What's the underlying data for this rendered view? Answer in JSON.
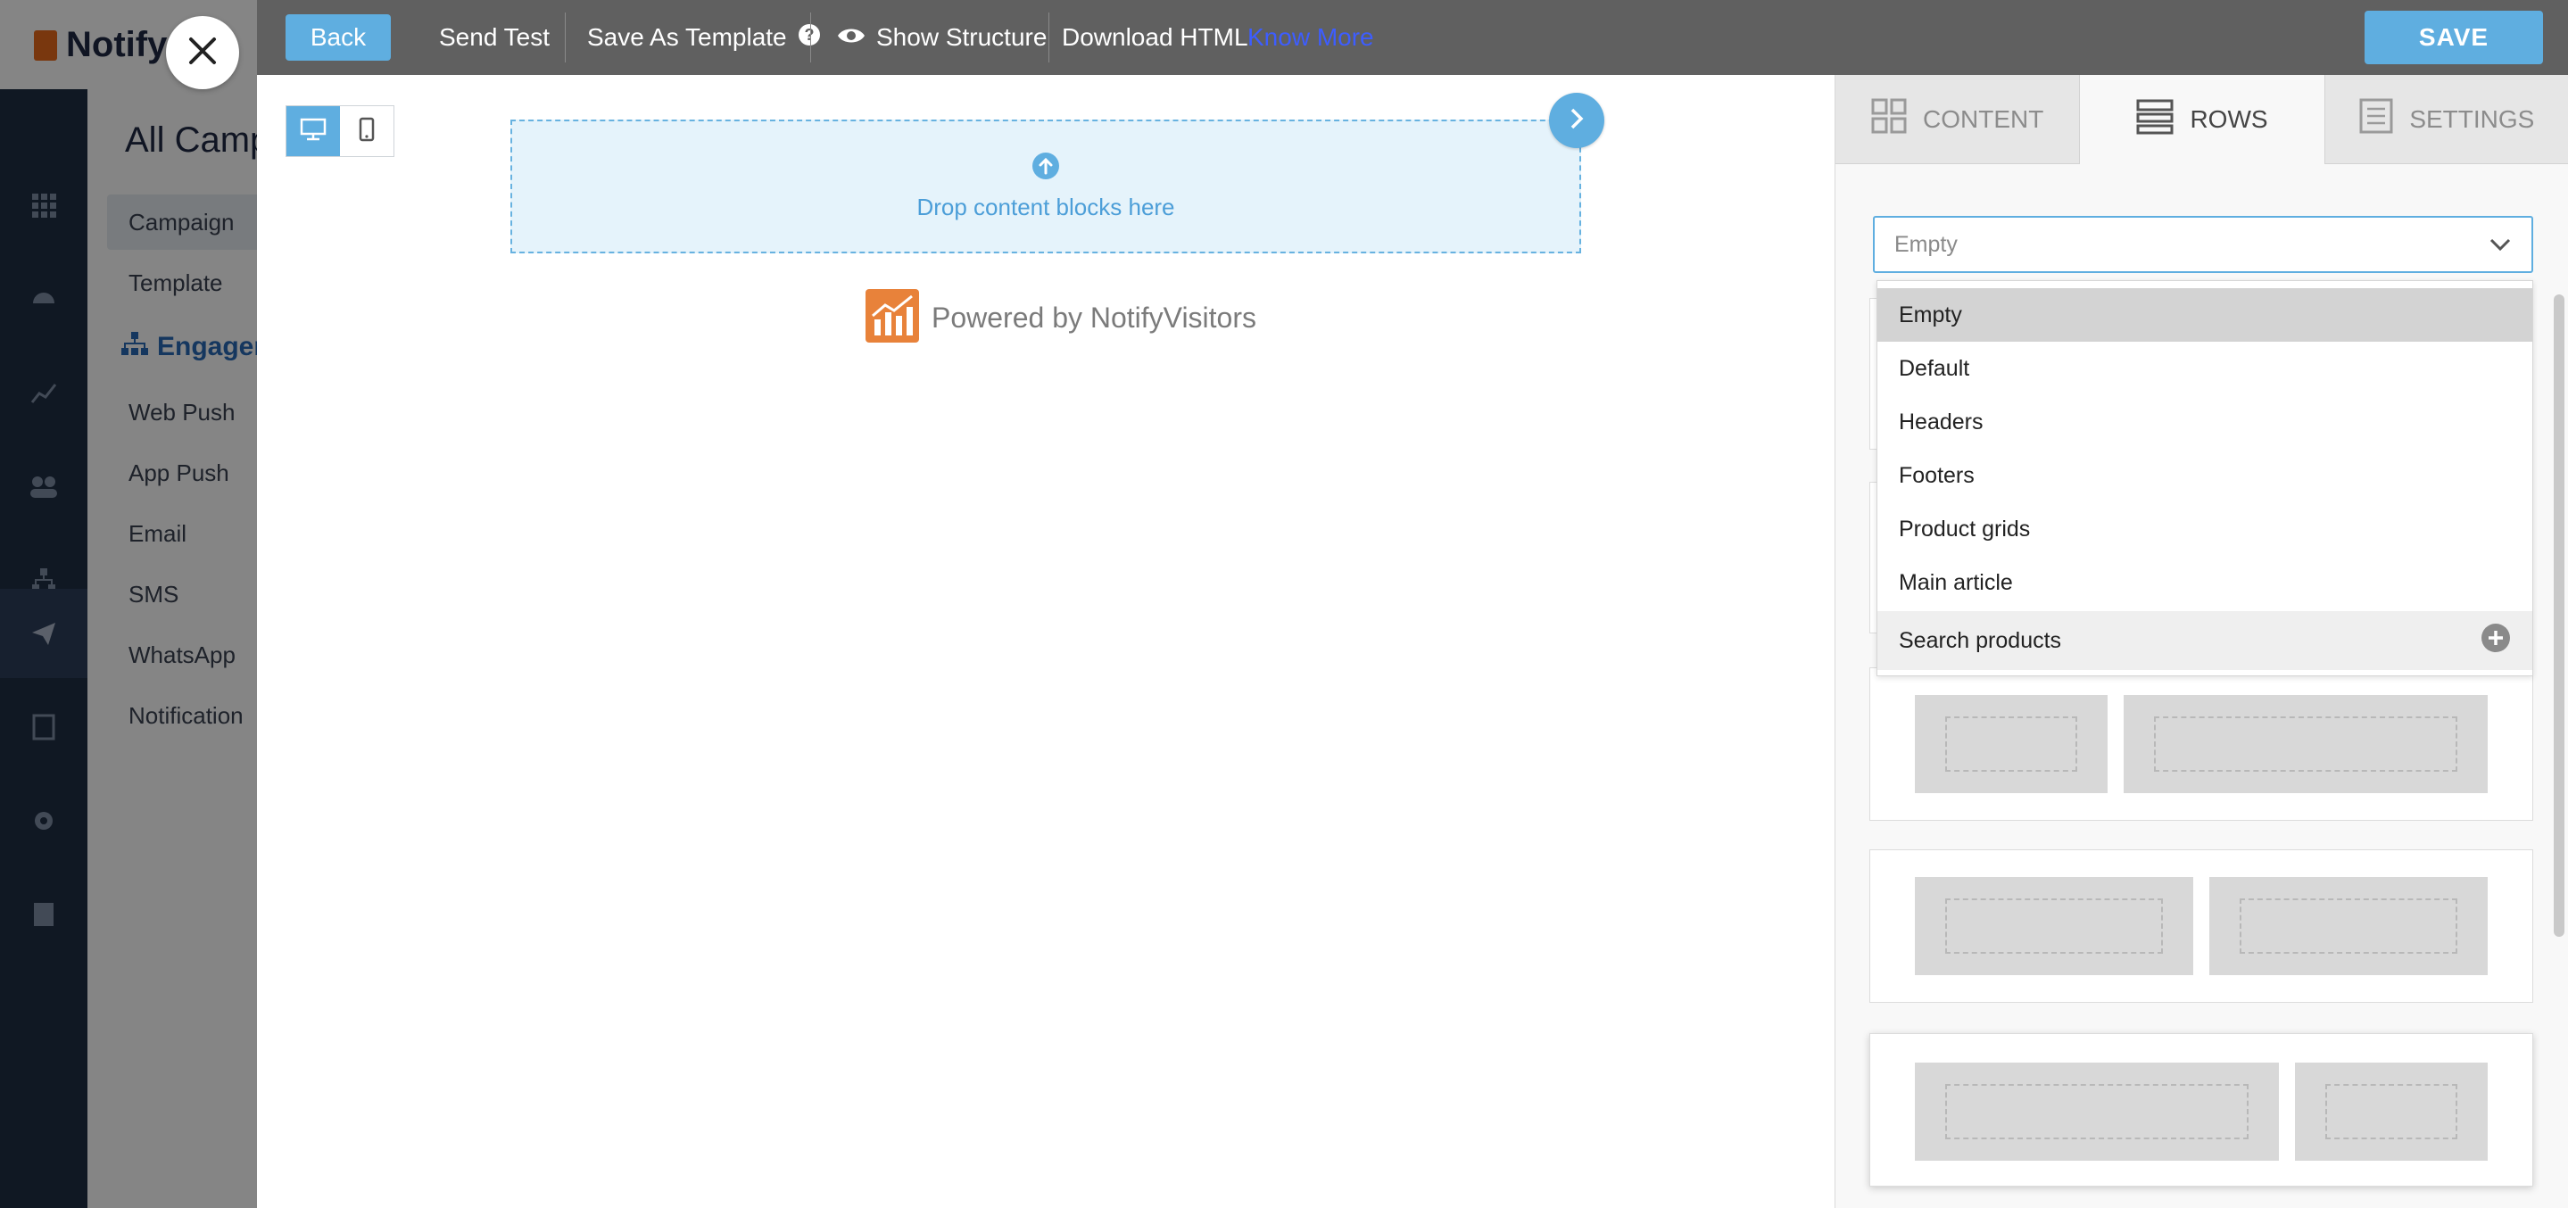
{
  "app": {
    "logo_text": "Notify",
    "page_title": "All Camp",
    "subnav": {
      "campaign": "Campaign",
      "template": "Template",
      "section": "Engager",
      "items": [
        "Web Push",
        "App Push",
        "Email",
        "SMS",
        "WhatsApp",
        "Notification"
      ]
    }
  },
  "toolbar": {
    "back_label": "Back",
    "send_test_label": "Send Test",
    "save_as_template_label": "Save As Template",
    "show_structure_label": "Show Structure",
    "download_html_label": "Download HTML",
    "know_more_label": "Know More",
    "save_label": "SAVE"
  },
  "canvas": {
    "drop_label": "Drop content blocks here",
    "powered_by": "Powered by NotifyVisitors"
  },
  "panel": {
    "tabs": [
      {
        "label": "CONTENT",
        "icon": "grid-icon"
      },
      {
        "label": "ROWS",
        "icon": "rows-icon"
      },
      {
        "label": "SETTINGS",
        "icon": "settings-list-icon"
      }
    ],
    "active_tab": "ROWS",
    "rows_select": {
      "value": "Empty",
      "options": [
        "Empty",
        "Default",
        "Headers",
        "Footers",
        "Product grids",
        "Main article",
        "Search products"
      ]
    }
  },
  "colors": {
    "accent": "#5faee0",
    "toolbar_bg": "#606060",
    "link": "#3d5dff",
    "brand_orange": "#e86a1c"
  }
}
